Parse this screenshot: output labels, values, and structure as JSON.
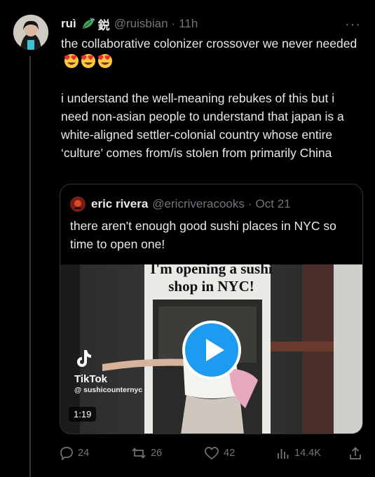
{
  "tweet": {
    "author_name": "ruì",
    "author_extra": "鋭",
    "handle": "@ruisbian",
    "separator": "·",
    "time": "11h",
    "more": "···",
    "paragraph_1": "the collaborative colonizer crossover we never needed",
    "paragraph_2": "i understand the well-meaning rebukes of this but i need non-asian people to understand that japan is a white-aligned settler-colonial country whose entire ‘culture’ comes from/is stolen from primarily China"
  },
  "quote": {
    "author_name": "eric rivera",
    "handle": "@ericriveracooks",
    "separator": "·",
    "date": "Oct 21",
    "text": "there aren't enough good sushi places in NYC so time to open one!",
    "video": {
      "overlay_line_1": "I'm opening a sushi",
      "overlay_line_2": "shop in NYC!",
      "brand": "TikTok",
      "tiktok_user": "@ sushicounternyc",
      "duration": "1:19"
    }
  },
  "actions": {
    "replies": "24",
    "retweets": "26",
    "likes": "42",
    "views": "14.4K"
  },
  "colors": {
    "background": "#000000",
    "text": "#e7e9ea",
    "muted": "#71767b",
    "accent": "#1d9bf0"
  }
}
